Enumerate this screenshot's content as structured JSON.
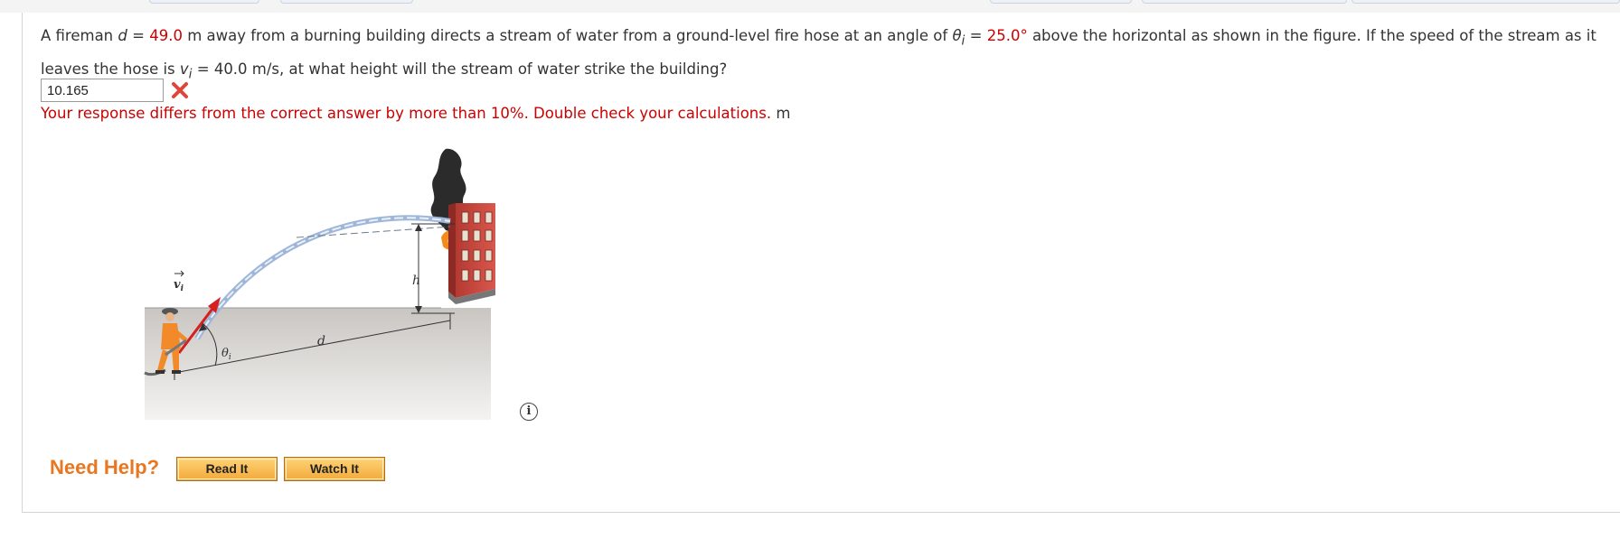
{
  "question": {
    "part1": "A fireman ",
    "d_symbol": "d",
    "eq1": " = ",
    "d_value": "49.0",
    "part2": " m away from a burning building directs a stream of water from a ground-level fire hose at an angle of ",
    "theta_symbol": "θ",
    "theta_sub": "i",
    "eq2": " = ",
    "theta_value": "25.0°",
    "part3": " above the horizontal as shown in the figure. If the speed of the stream as it leaves the hose is ",
    "v_symbol": "v",
    "v_sub": "i",
    "part4": " = 40.0 m/s, at what height will the stream of water strike the building?"
  },
  "answer": {
    "value": "10.165",
    "status_icon": "x-mark-icon"
  },
  "feedback": {
    "message": "Your response differs from the correct answer by more than 10%. Double check your calculations.",
    "unit": " m"
  },
  "figure": {
    "label_v": "v",
    "label_v_sub": "i",
    "label_theta": "θ",
    "label_theta_sub": "i",
    "label_d": "d",
    "label_h": "h"
  },
  "info_icon": "i",
  "help": {
    "label": "Need Help?",
    "read_it": "Read It",
    "watch_it": "Watch It"
  },
  "colors": {
    "accent_red": "#cc0000",
    "help_orange": "#e87722",
    "button_fill": "#f2a93b"
  }
}
